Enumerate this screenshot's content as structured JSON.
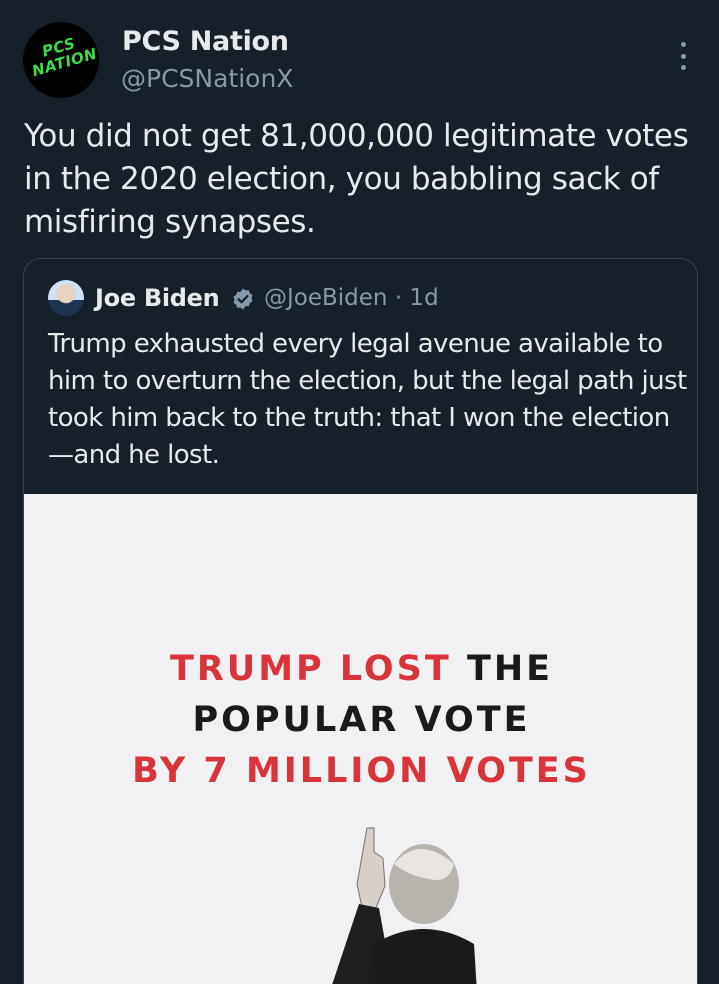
{
  "author": {
    "name": "PCS Nation",
    "handle": "@PCSNationX",
    "avatar_text": "PCS NATION"
  },
  "tweet": {
    "text": "You did not get 81,000,000 legitimate votes in the 2020 election, you babbling sack of misfiring synapses."
  },
  "quoted": {
    "name": "Joe Biden",
    "handle_time": "@JoeBiden · 1d",
    "text": "Trump exhausted every legal avenue available to him to overturn the election, but the legal path just took him back to the truth: that I won the election—and he lost.",
    "media": {
      "line1_red": "TRUMP LOST",
      "line1_dark": "THE",
      "line2": "POPULAR VOTE",
      "line3_red": "BY 7 MILLION VOTES"
    }
  },
  "icons": {
    "more": "more-vertical-icon",
    "verified": "verified-badge-icon"
  },
  "colors": {
    "background": "#15202b",
    "text": "#e7e9ea",
    "secondary": "#8b98a5",
    "accent_green": "#3ddc4a",
    "headline_red": "#d9343b"
  }
}
